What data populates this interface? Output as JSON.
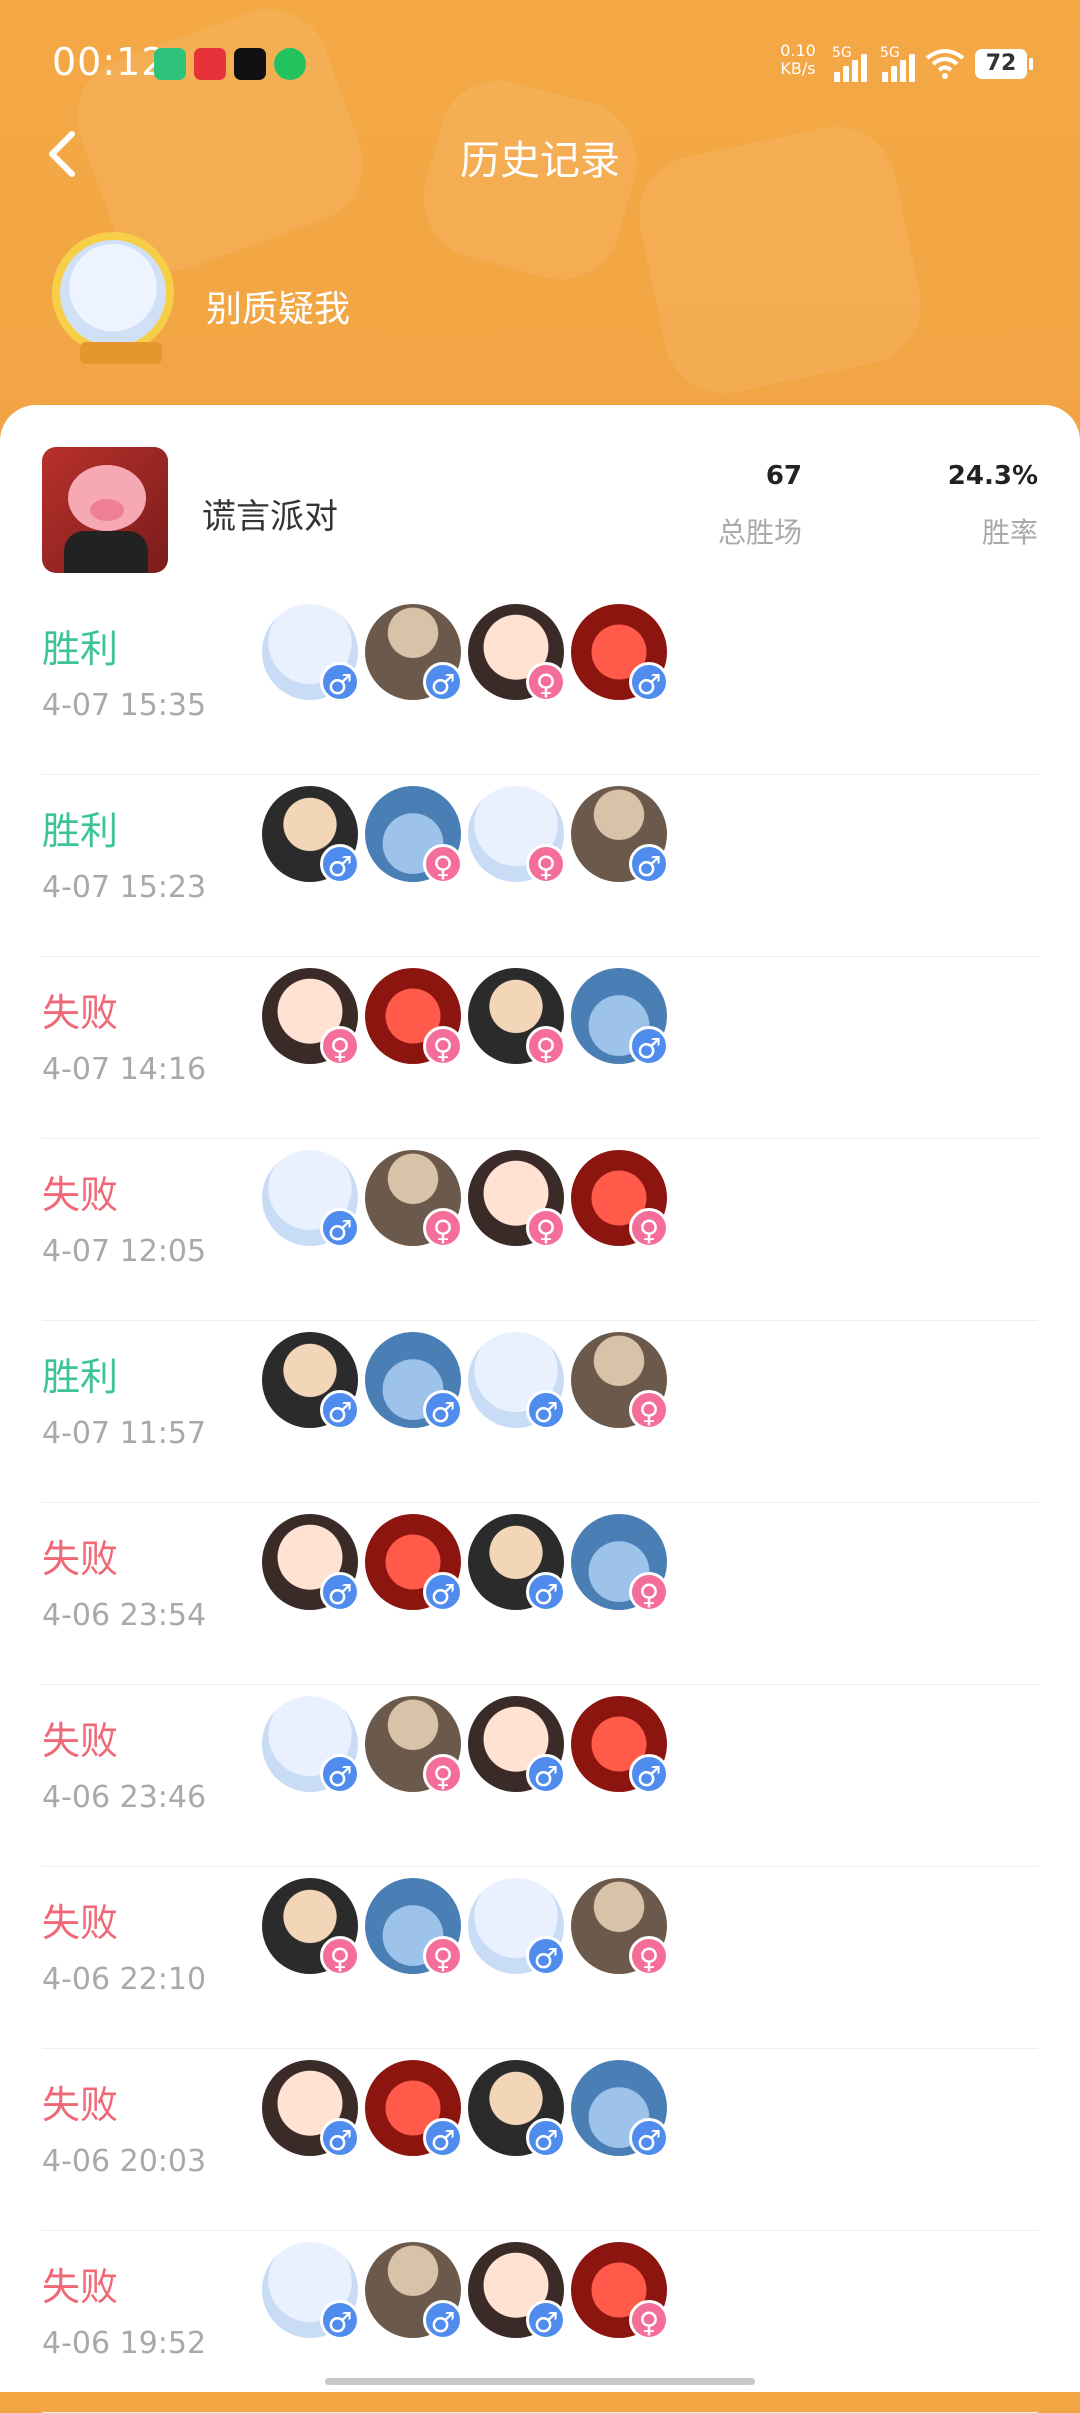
{
  "status_bar": {
    "time": "00:12",
    "net_speed": "0.10",
    "net_unit": "KB/s",
    "signal_1": "5G",
    "signal_2": "5G",
    "battery": "72",
    "notification_icons": [
      "mi-app-icon",
      "red-app-icon",
      "cut-app-icon",
      "wechat-icon"
    ]
  },
  "header": {
    "title": "历史记录",
    "back_icon": "chevron-left-icon"
  },
  "profile": {
    "nickname": "别质疑我"
  },
  "game": {
    "name": "谎言派对",
    "total_wins_value": "67",
    "total_wins_label": "总胜场",
    "win_rate_value": "24.3%",
    "win_rate_label": "胜率"
  },
  "matches": [
    {
      "result": "胜利",
      "outcome": "win",
      "time": "4-07 15:35",
      "players": [
        "male",
        "male",
        "female",
        "male"
      ]
    },
    {
      "result": "胜利",
      "outcome": "win",
      "time": "4-07 15:23",
      "players": [
        "male",
        "female",
        "female",
        "male"
      ]
    },
    {
      "result": "失败",
      "outcome": "lose",
      "time": "4-07 14:16",
      "players": [
        "female",
        "female",
        "female",
        "male"
      ]
    },
    {
      "result": "失败",
      "outcome": "lose",
      "time": "4-07 12:05",
      "players": [
        "male",
        "female",
        "female",
        "female"
      ]
    },
    {
      "result": "胜利",
      "outcome": "win",
      "time": "4-07 11:57",
      "players": [
        "male",
        "male",
        "male",
        "female"
      ]
    },
    {
      "result": "失败",
      "outcome": "lose",
      "time": "4-06 23:54",
      "players": [
        "male",
        "male",
        "male",
        "female"
      ]
    },
    {
      "result": "失败",
      "outcome": "lose",
      "time": "4-06 23:46",
      "players": [
        "male",
        "female",
        "male",
        "male"
      ]
    },
    {
      "result": "失败",
      "outcome": "lose",
      "time": "4-06 22:10",
      "players": [
        "female",
        "female",
        "male",
        "female"
      ]
    },
    {
      "result": "失败",
      "outcome": "lose",
      "time": "4-06 20:03",
      "players": [
        "male",
        "male",
        "male",
        "male"
      ]
    },
    {
      "result": "失败",
      "outcome": "lose",
      "time": "4-06 19:52",
      "players": [
        "male",
        "male",
        "male",
        "female"
      ]
    }
  ],
  "gender_symbols": {
    "male": "♂",
    "female": "♀"
  },
  "colors": {
    "header_bg": "#f3a744",
    "win": "#3cc495",
    "lose": "#f06877",
    "male_badge": "#4f8cee",
    "female_badge": "#f46e99"
  }
}
